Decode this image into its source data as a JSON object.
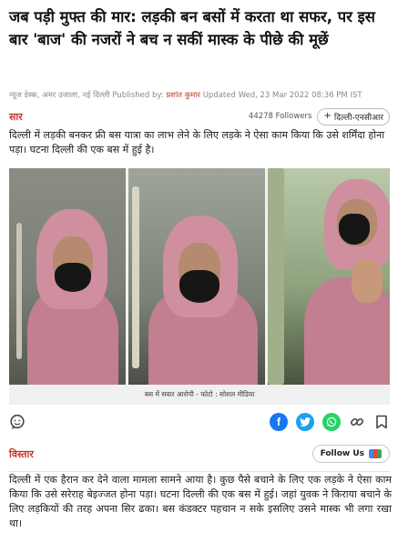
{
  "article": {
    "headline": "जब पड़ी मुफ्त की मार: लड़की बन बसों में करता था सफर, पर इस बार 'बाज' की नजरों ने बच न सकीं मास्क के पीछे की मूछें",
    "byline": {
      "prefix": "न्यूज डेस्क, अमर उजाला, नई दिल्ली Published by: ",
      "author": "प्रशांत कुमार",
      "updated": " Updated Wed, 23 Mar 2022 08:36 PM IST"
    },
    "summary_section": {
      "label": "सार",
      "followers": "44278 Followers",
      "city_chip": "दिल्ली-एनसीआर",
      "text": "दिल्ली में लड़की बनकर फ्री बस यात्रा का लाभ लेने के लिए लड़के ने ऐसा काम किया कि उसे शर्मिंदा होना पड़ा। घटना दिल्ली की एक बस में हुई है।"
    },
    "photo": {
      "caption": "बस में सवार आरोपी - फोटो : सोशल मीडिया"
    },
    "share": {
      "icons": [
        "comment-icon",
        "facebook-icon",
        "twitter-icon",
        "whatsapp-icon",
        "link-icon",
        "bookmark-icon"
      ]
    },
    "detail_section": {
      "label": "विस्तार",
      "follow_button": "Follow Us",
      "text": "दिल्ली में एक हैरान कर देने वाला मामला सामने आया है। कुछ पैसे बचाने के लिए एक लड़के ने ऐसा काम किया कि उसे सरेराह बेइज्जत होना पड़ा। घटना दिल्ली की एक बस में हुई। जहां युवक ने किराया बचाने के लिए लड़कियों की तरह अपना सिर ढका। बस कंडक्टर पहचान न सके इसलिए उसने मास्क भी लगा रखा था।"
    }
  },
  "colors": {
    "accent": "#c0392b",
    "facebook": "#1877f2",
    "twitter": "#1da1f2",
    "whatsapp": "#25d366"
  }
}
